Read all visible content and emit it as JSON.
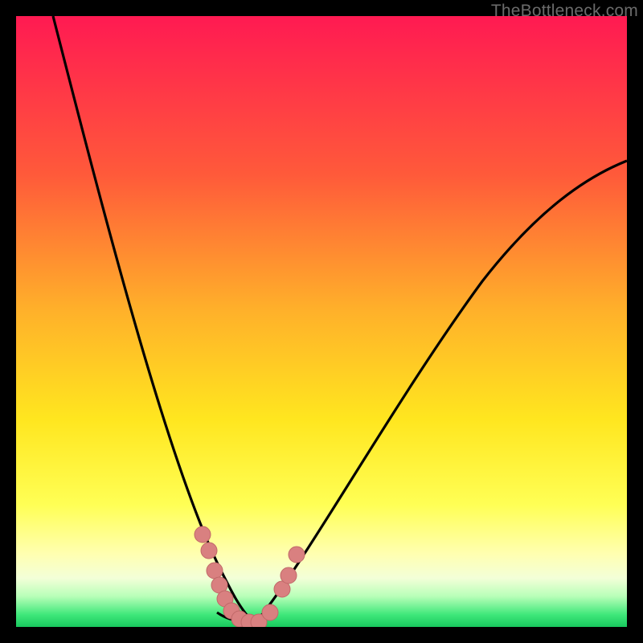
{
  "watermark": "TheBottleneck.com",
  "colors": {
    "bg_black": "#000000",
    "gradient_top": "#ff1a52",
    "gradient_mid1": "#ff7a33",
    "gradient_mid2": "#ffd21f",
    "gradient_mid3": "#ffff3a",
    "gradient_pale": "#ffffc8",
    "gradient_green": "#1fe06a",
    "curve": "#000000",
    "marker_fill": "#d98080",
    "marker_stroke": "#c06868"
  },
  "chart_data": {
    "type": "line",
    "title": "",
    "xlabel": "",
    "ylabel": "",
    "xlim": [
      0,
      100
    ],
    "ylim": [
      0,
      100
    ],
    "optimum_x": 36,
    "series": [
      {
        "name": "bottleneck-curve",
        "x": [
          6,
          8,
          10,
          12,
          14,
          16,
          18,
          20,
          22,
          24,
          26,
          28,
          30,
          32,
          34,
          36,
          38,
          40,
          42,
          44,
          48,
          52,
          56,
          60,
          64,
          68,
          72,
          76,
          80,
          84,
          88,
          92,
          96,
          100
        ],
        "y": [
          100,
          92,
          84,
          76,
          68,
          60,
          53,
          46,
          39,
          33,
          27,
          21,
          16,
          11,
          6,
          2,
          0,
          2,
          6,
          10,
          18,
          25,
          32,
          38,
          44,
          49,
          54,
          58,
          62,
          65,
          68,
          71,
          73,
          75
        ]
      }
    ],
    "markers": {
      "name": "highlighted-points",
      "points": [
        {
          "x": 30.5,
          "y": 15
        },
        {
          "x": 31.5,
          "y": 11
        },
        {
          "x": 32.5,
          "y": 7
        },
        {
          "x": 33.0,
          "y": 4
        },
        {
          "x": 34.0,
          "y": 2
        },
        {
          "x": 35.5,
          "y": 0.5
        },
        {
          "x": 37.0,
          "y": 0.3
        },
        {
          "x": 38.5,
          "y": 0.5
        },
        {
          "x": 40.0,
          "y": 1.5
        },
        {
          "x": 42.5,
          "y": 6
        },
        {
          "x": 43.5,
          "y": 9
        },
        {
          "x": 45.0,
          "y": 13
        }
      ]
    },
    "gradient_bands": [
      {
        "y": 100,
        "color": "#ff1a52"
      },
      {
        "y": 70,
        "color": "#ff7a33"
      },
      {
        "y": 45,
        "color": "#ffd21f"
      },
      {
        "y": 25,
        "color": "#ffff3a"
      },
      {
        "y": 12,
        "color": "#ffffc8"
      },
      {
        "y": 3,
        "color": "#1fe06a"
      }
    ]
  }
}
